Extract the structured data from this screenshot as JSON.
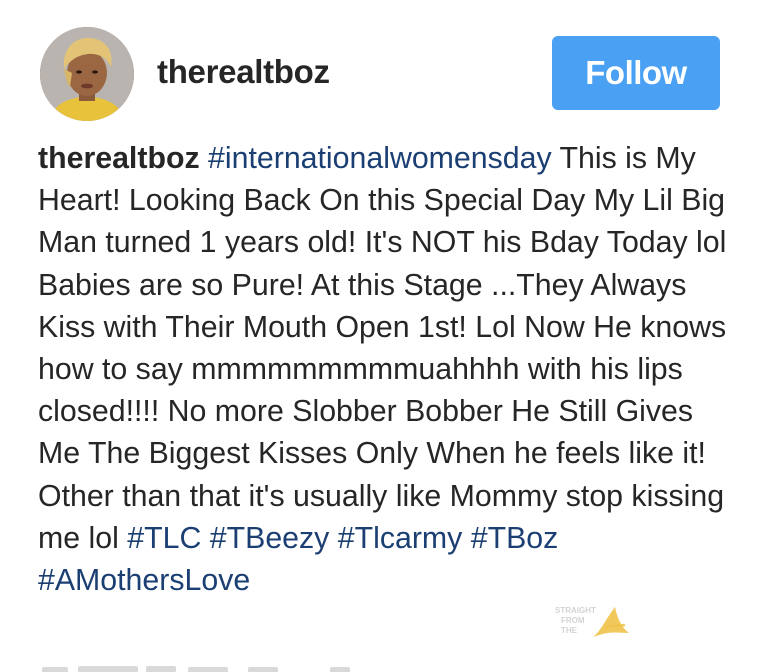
{
  "post": {
    "author": {
      "username": "therealtboz",
      "avatar_icon": "profile-photo"
    },
    "follow_button": {
      "label": "Follow",
      "color": "#4aa0f2"
    },
    "caption": {
      "username": "therealtboz",
      "hashtag_color": "#1b3f73",
      "segments": [
        {
          "type": "tag",
          "text": "#internationalwomensday"
        },
        {
          "type": "text",
          "text": " This is My Heart! Looking Back On this Special Day My Lil Big Man turned 1 years old! It's NOT his Bday Today lol Babies are so Pure! At this Stage ...They Always Kiss with Their Mouth Open 1st! Lol Now He knows how to say mmmmmmmmmuahhhh with his lips closed!!!! No more Slobber Bobber He Still Gives Me The Biggest Kisses Only When he feels like it! Other than that it's usually like Mommy stop kissing me lol "
        },
        {
          "type": "tag",
          "text": "#TLC"
        },
        {
          "type": "text",
          "text": " "
        },
        {
          "type": "tag",
          "text": "#TBeezy"
        },
        {
          "type": "text",
          "text": " "
        },
        {
          "type": "tag",
          "text": "#Tlcarmy"
        },
        {
          "type": "text",
          "text": " "
        },
        {
          "type": "tag",
          "text": "#TBoz"
        },
        {
          "type": "text",
          "text": " "
        },
        {
          "type": "tag",
          "text": "#AMothersLove"
        }
      ]
    },
    "watermark": {
      "text_lines": [
        "STRAIGHT",
        "FROM",
        "THE"
      ],
      "logo_letter": "A",
      "logo_color": "#e8b13a"
    }
  }
}
